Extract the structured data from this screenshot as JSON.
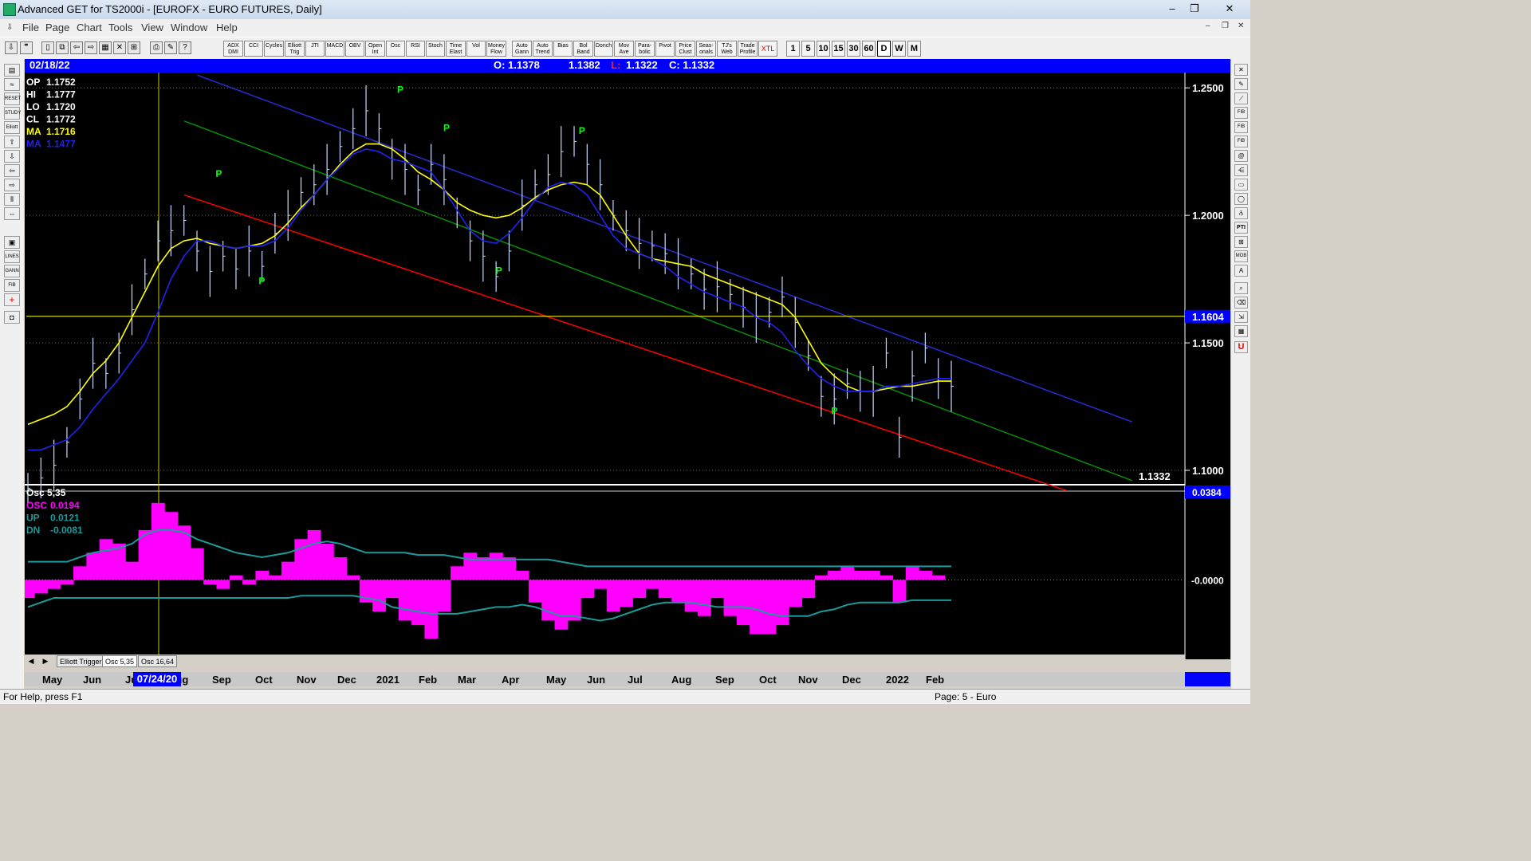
{
  "window": {
    "title": "Advanced GET for TS2000i - [EUROFX - EURO FUTURES, Daily]",
    "buttons": [
      "–",
      "❐",
      "✕"
    ]
  },
  "menu": [
    "File",
    "Page",
    "Chart",
    "Tools",
    "View",
    "Window",
    "Help"
  ],
  "toolbar": {
    "indicators": [
      "ADX DMI",
      "CCI",
      "Cycles",
      "Elliott Trig",
      "JTI",
      "MACD",
      "OBV",
      "Open Int",
      "Osc",
      "RSI",
      "Stoch",
      "Time Elast",
      "Vol",
      "Money Flow",
      "Auto Gann",
      "Auto Trend",
      "Bias",
      "Bol Band",
      "Donch",
      "Mov Ave",
      "Para- bolic",
      "Pivot",
      "Price Clust",
      "Seas- onals",
      "TJ's Web",
      "Trade Profile",
      "XTL"
    ],
    "timeframes": [
      "1",
      "5",
      "10",
      "15",
      "30",
      "60",
      "D",
      "W",
      "M"
    ],
    "active_timeframe": "D"
  },
  "header": {
    "date": "02/18/22",
    "open": "O: 1.1378",
    "high": "1.1382",
    "low_label": "L:",
    "low": "1.1322",
    "close": "C: 1.1332"
  },
  "price_panel": {
    "readouts": [
      {
        "label": "OP",
        "value": "1.1752",
        "color": "#ffffff"
      },
      {
        "label": "HI",
        "value": "1.1777",
        "color": "#ffffff"
      },
      {
        "label": "LO",
        "value": "1.1720",
        "color": "#ffffff"
      },
      {
        "label": "CL",
        "value": "1.1772",
        "color": "#ffffff"
      },
      {
        "label": "MA",
        "value": "1.1716",
        "color": "#ffff00"
      },
      {
        "label": "MA",
        "value": "1.1477",
        "color": "#2222ee"
      }
    ],
    "y_ticks": [
      "1.2500",
      "1.2000",
      "1.1500",
      "1.1000"
    ],
    "highlight_price": "1.1604",
    "last_price": "1.1332",
    "pivot_marker": "P"
  },
  "osc_panel": {
    "title": "Osc 5,35",
    "readouts": [
      {
        "label": "OSC",
        "value": "0.0194",
        "color": "#ff00ff"
      },
      {
        "label": "UP",
        "value": "0.0121",
        "color": "#1a9a9a"
      },
      {
        "label": "DN",
        "value": "-0.0081",
        "color": "#1a9a9a"
      }
    ],
    "current_value": "0.0384",
    "zero_label": "-0.0000"
  },
  "tabs": [
    "Elliott Trigger",
    "Osc 5,35",
    "Osc 16,64"
  ],
  "dates": {
    "months": [
      "May",
      "Jun",
      "Jul",
      "Aug",
      "Sep",
      "Oct",
      "Nov",
      "Dec",
      "2021",
      "Feb",
      "Mar",
      "Apr",
      "May",
      "Jun",
      "Jul",
      "Aug",
      "Sep",
      "Oct",
      "Nov",
      "Dec",
      "2022",
      "Feb"
    ],
    "cursor_date": "07/24/20"
  },
  "status": {
    "help": "For Help, press F1",
    "page": "Page: 5 - Euro"
  },
  "colors": {
    "header_bg": "#0000ff",
    "chart_bg": "#000000",
    "moving_avg_fast": "#ffff00",
    "moving_avg_slow": "#2222ee",
    "channel_upper": "#2a2ad0",
    "channel_mid": "#0a8a0a",
    "channel_lower": "#ff0000",
    "pivot": "#00ff00",
    "oscillator": "#ff00ff",
    "bands": "#1a9a9a"
  },
  "chart_data": {
    "type": "line",
    "title": "EUROFX - EURO FUTURES, Daily",
    "ylim": [
      1.095,
      1.256
    ],
    "y_ticks": [
      1.25,
      1.2,
      1.15,
      1.1
    ],
    "x_labels": [
      "May",
      "Jun",
      "Jul",
      "Aug",
      "Sep",
      "Oct",
      "Nov",
      "Dec",
      "2021",
      "Feb",
      "Mar",
      "Apr",
      "May",
      "Jun",
      "Jul",
      "Aug",
      "Sep",
      "Oct",
      "Nov",
      "Dec",
      "2022",
      "Feb"
    ],
    "series": [
      {
        "values": [
          1.093,
          1.097,
          1.102,
          1.111,
          1.128,
          1.142,
          1.138,
          1.146,
          1.163,
          1.177,
          1.19,
          1.194,
          1.198,
          1.186,
          1.178,
          1.184,
          1.179,
          1.186,
          1.18,
          1.193,
          1.2,
          1.209,
          1.212,
          1.218,
          1.227,
          1.234,
          1.241,
          1.234,
          1.222,
          1.218,
          1.21,
          1.22,
          1.214,
          1.201,
          1.19,
          1.184,
          1.176,
          1.186,
          1.204,
          1.212,
          1.216,
          1.225,
          1.229,
          1.22,
          1.212,
          1.2,
          1.194,
          1.189,
          1.188,
          1.185,
          1.181,
          1.177,
          1.171,
          1.172,
          1.169,
          1.164,
          1.16,
          1.162,
          1.168,
          1.158,
          1.145,
          1.129,
          1.128,
          1.134,
          1.131,
          1.131,
          1.146,
          1.113,
          1.137,
          1.148,
          1.136,
          1.133
        ]
      },
      {
        "name": "MA 1.1716",
        "values": [
          1.118,
          1.12,
          1.122,
          1.125,
          1.131,
          1.138,
          1.143,
          1.15,
          1.16,
          1.17,
          1.18,
          1.187,
          1.19,
          1.191,
          1.189,
          1.188,
          1.187,
          1.188,
          1.189,
          1.192,
          1.197,
          1.203,
          1.208,
          1.214,
          1.22,
          1.225,
          1.228,
          1.228,
          1.226,
          1.222,
          1.217,
          1.214,
          1.21,
          1.205,
          1.202,
          1.2,
          1.199,
          1.2,
          1.203,
          1.207,
          1.21,
          1.212,
          1.213,
          1.212,
          1.208,
          1.2,
          1.192,
          1.185,
          1.183,
          1.182,
          1.181,
          1.18,
          1.177,
          1.175,
          1.173,
          1.171,
          1.169,
          1.167,
          1.165,
          1.16,
          1.151,
          1.142,
          1.137,
          1.133,
          1.131,
          1.131,
          1.132,
          1.133,
          1.133,
          1.134,
          1.135,
          1.135
        ]
      },
      {
        "name": "MA 1.1477",
        "values": [
          1.108,
          1.108,
          1.11,
          1.112,
          1.117,
          1.124,
          1.13,
          1.136,
          1.143,
          1.15,
          1.162,
          1.175,
          1.184,
          1.19,
          1.19,
          1.188,
          1.187,
          1.188,
          1.188,
          1.19,
          1.195,
          1.202,
          1.208,
          1.214,
          1.219,
          1.224,
          1.226,
          1.225,
          1.222,
          1.221,
          1.219,
          1.217,
          1.21,
          1.202,
          1.194,
          1.19,
          1.189,
          1.193,
          1.199,
          1.206,
          1.211,
          1.213,
          1.212,
          1.208,
          1.2,
          1.192,
          1.187,
          1.185,
          1.183,
          1.18,
          1.176,
          1.173,
          1.17,
          1.168,
          1.166,
          1.164,
          1.16,
          1.158,
          1.154,
          1.147,
          1.141,
          1.136,
          1.133,
          1.131,
          1.131,
          1.131,
          1.133,
          1.133,
          1.134,
          1.135,
          1.136,
          1.136
        ]
      }
    ],
    "osc_ylim": [
      -0.033,
      0.041
    ],
    "oscillator": [
      -0.008,
      -0.006,
      -0.004,
      -0.002,
      0.006,
      0.012,
      0.018,
      0.016,
      0.008,
      0.022,
      0.034,
      0.03,
      0.024,
      0.014,
      -0.002,
      -0.004,
      0.002,
      -0.002,
      0.004,
      0.002,
      0.008,
      0.018,
      0.022,
      0.016,
      0.01,
      0.002,
      -0.01,
      -0.014,
      -0.008,
      -0.018,
      -0.02,
      -0.026,
      -0.014,
      0.006,
      0.012,
      0.01,
      0.012,
      0.01,
      0.004,
      -0.01,
      -0.018,
      -0.022,
      -0.018,
      -0.008,
      -0.004,
      -0.014,
      -0.012,
      -0.008,
      -0.004,
      -0.008,
      -0.01,
      -0.014,
      -0.016,
      -0.008,
      -0.016,
      -0.02,
      -0.024,
      -0.024,
      -0.02,
      -0.012,
      -0.008,
      0.002,
      0.004,
      0.006,
      0.004,
      0.004,
      0.002,
      -0.01,
      0.006,
      0.004,
      0.002,
      0.0
    ],
    "upper_band": [
      0.008,
      0.008,
      0.008,
      0.008,
      0.01,
      0.012,
      0.013,
      0.014,
      0.016,
      0.02,
      0.022,
      0.022,
      0.021,
      0.018,
      0.016,
      0.014,
      0.012,
      0.011,
      0.01,
      0.011,
      0.012,
      0.014,
      0.016,
      0.017,
      0.016,
      0.014,
      0.012,
      0.012,
      0.012,
      0.012,
      0.011,
      0.011,
      0.011,
      0.01,
      0.009,
      0.009,
      0.009,
      0.009,
      0.009,
      0.009,
      0.009,
      0.008,
      0.007,
      0.006,
      0.006,
      0.006,
      0.006,
      0.006,
      0.006,
      0.006,
      0.006,
      0.006,
      0.006,
      0.006,
      0.006,
      0.006,
      0.006,
      0.006,
      0.006,
      0.006,
      0.006,
      0.006,
      0.006,
      0.006,
      0.006,
      0.006,
      0.006,
      0.006,
      0.006,
      0.006,
      0.006,
      0.006
    ],
    "lower_band": [
      -0.012,
      -0.01,
      -0.008,
      -0.008,
      -0.008,
      -0.008,
      -0.008,
      -0.008,
      -0.008,
      -0.008,
      -0.008,
      -0.008,
      -0.008,
      -0.008,
      -0.008,
      -0.008,
      -0.008,
      -0.008,
      -0.008,
      -0.008,
      -0.008,
      -0.007,
      -0.007,
      -0.007,
      -0.007,
      -0.007,
      -0.008,
      -0.009,
      -0.012,
      -0.013,
      -0.014,
      -0.015,
      -0.015,
      -0.015,
      -0.014,
      -0.013,
      -0.012,
      -0.012,
      -0.011,
      -0.012,
      -0.014,
      -0.016,
      -0.016,
      -0.017,
      -0.018,
      -0.017,
      -0.015,
      -0.013,
      -0.011,
      -0.01,
      -0.01,
      -0.01,
      -0.011,
      -0.012,
      -0.012,
      -0.012,
      -0.013,
      -0.015,
      -0.016,
      -0.016,
      -0.016,
      -0.014,
      -0.013,
      -0.011,
      -0.01,
      -0.01,
      -0.01,
      -0.01,
      -0.009,
      -0.009,
      -0.009,
      -0.009
    ],
    "channels": [
      {
        "color": "#2a2ad0",
        "from": {
          "i": 13,
          "y": 1.255
        },
        "to": {
          "i": 85,
          "y": 1.119
        }
      },
      {
        "color": "#0a8a0a",
        "from": {
          "i": 12,
          "y": 1.237
        },
        "to": {
          "i": 85,
          "y": 1.096
        }
      },
      {
        "color": "#ff0000",
        "from": {
          "i": 12,
          "y": 1.208
        },
        "to": {
          "i": 80,
          "y": 1.092
        }
      }
    ],
    "pivots": [
      {
        "i": 6.2,
        "y": 1.215
      },
      {
        "i": 7.6,
        "y": 1.173
      },
      {
        "i": 12.1,
        "y": 1.248
      },
      {
        "i": 13.6,
        "y": 1.233
      },
      {
        "i": 15.3,
        "y": 1.177
      },
      {
        "i": 18.0,
        "y": 1.232
      },
      {
        "i": 26.2,
        "y": 1.122
      }
    ]
  }
}
